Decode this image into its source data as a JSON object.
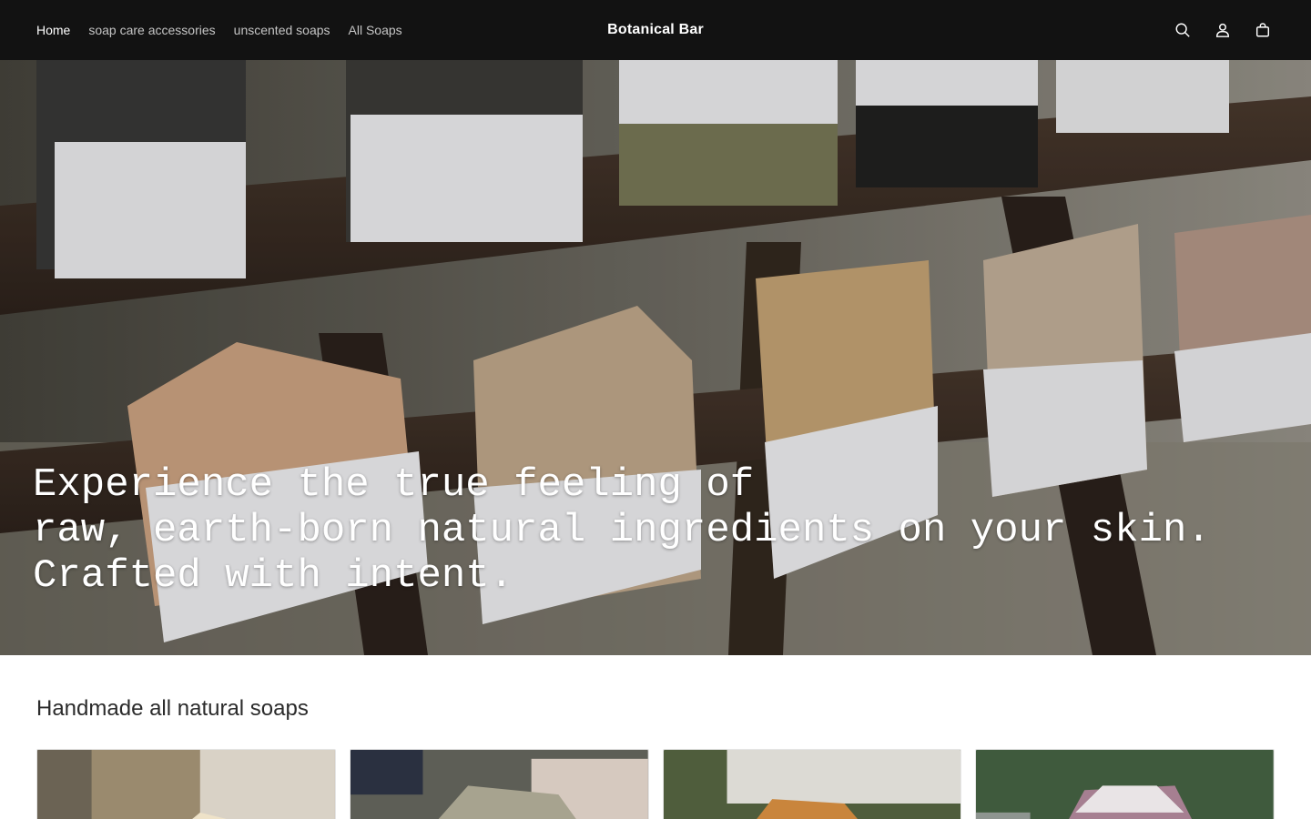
{
  "header": {
    "nav": [
      {
        "label": "Home",
        "active": true
      },
      {
        "label": "soap care accessories",
        "active": false
      },
      {
        "label": "unscented soaps",
        "active": false
      },
      {
        "label": "All Soaps",
        "active": false
      }
    ],
    "logo": "Botanical Bar",
    "icons": [
      "search-icon",
      "account-icon",
      "cart-icon"
    ]
  },
  "hero": {
    "lines": [
      "Experience the true feeling of",
      "raw, earth-born natural ingredients on your skin.",
      "Crafted with intent."
    ]
  },
  "collection": {
    "title": "Handmade all natural soaps"
  },
  "colors": {
    "header_bg": "#121212",
    "nav_text": "#ffffff"
  }
}
